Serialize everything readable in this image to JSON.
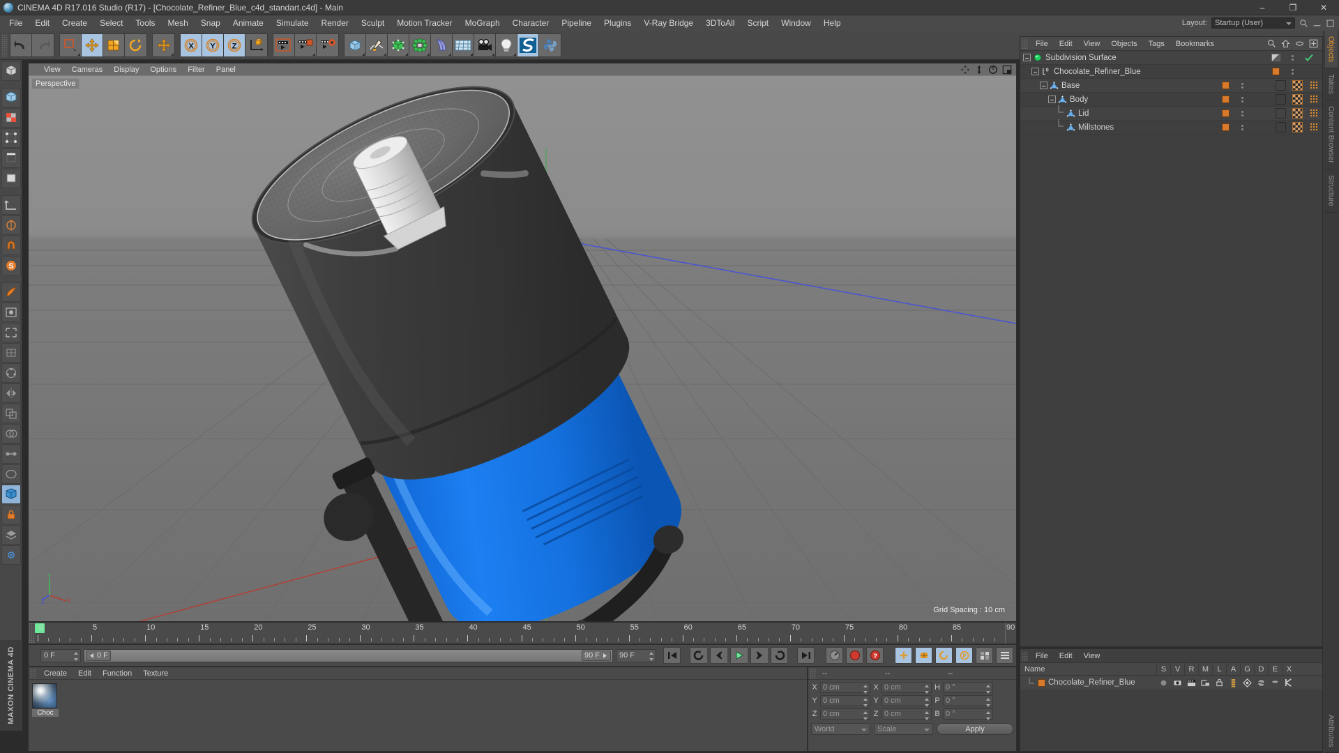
{
  "window": {
    "title": "CINEMA 4D R17.016 Studio (R17) - [Chocolate_Refiner_Blue_c4d_standart.c4d] - Main",
    "app_icon": "c4d-sphere-icon",
    "minimize": "–",
    "maximize": "❐",
    "close": "✕"
  },
  "menubar": {
    "items": [
      "File",
      "Edit",
      "Create",
      "Select",
      "Tools",
      "Mesh",
      "Snap",
      "Animate",
      "Simulate",
      "Render",
      "Sculpt",
      "Motion Tracker",
      "MoGraph",
      "Character",
      "Pipeline",
      "Plugins",
      "V-Ray Bridge",
      "3DToAll",
      "Script",
      "Window",
      "Help"
    ],
    "layout_label": "Layout:",
    "layout_value": "Startup (User)"
  },
  "toolbar": {
    "groups": [
      {
        "name": "history",
        "buttons": [
          {
            "name": "undo-button",
            "icon": "undo-arrow-icon",
            "active": false
          },
          {
            "name": "redo-button",
            "icon": "redo-arrow-icon",
            "active": false
          }
        ]
      },
      {
        "name": "selection-tools",
        "buttons": [
          {
            "name": "live-selection-button",
            "icon": "live-selection-icon",
            "active": false
          },
          {
            "name": "move-tool-button",
            "icon": "move-arrows-icon",
            "active": true
          },
          {
            "name": "scale-tool-button",
            "icon": "scale-box-icon",
            "active": false
          },
          {
            "name": "rotate-tool-button",
            "icon": "rotate-circle-icon",
            "active": false
          }
        ]
      },
      {
        "name": "transform",
        "buttons": [
          {
            "name": "transform-tool-button",
            "icon": "move-arrows-icon",
            "active": false
          }
        ]
      },
      {
        "name": "axis-locks",
        "buttons": [
          {
            "name": "x-axis-lock-button",
            "icon": "axis-x-icon",
            "active": true
          },
          {
            "name": "y-axis-lock-button",
            "icon": "axis-y-icon",
            "active": true
          },
          {
            "name": "z-axis-lock-button",
            "icon": "axis-z-icon",
            "active": true
          },
          {
            "name": "world-coordinate-button",
            "icon": "world-axis-cube-icon",
            "active": false
          }
        ]
      },
      {
        "name": "render",
        "buttons": [
          {
            "name": "render-view-button",
            "icon": "render-clapper-icon",
            "active": false
          },
          {
            "name": "render-to-picture-viewer-button",
            "icon": "render-picture-icon",
            "active": false
          },
          {
            "name": "render-settings-button",
            "icon": "render-settings-gear-icon",
            "active": false
          }
        ]
      },
      {
        "name": "create-objects",
        "buttons": [
          {
            "name": "add-cube-button",
            "icon": "cube-icon",
            "active": false
          },
          {
            "name": "add-spline-button",
            "icon": "pen-spline-icon",
            "active": false
          },
          {
            "name": "add-generator-button",
            "icon": "green-cube-generator-icon",
            "active": false
          },
          {
            "name": "add-array-button",
            "icon": "mograph-cloner-icon",
            "active": false
          },
          {
            "name": "add-deformer-button",
            "icon": "bend-deformer-icon",
            "active": false
          },
          {
            "name": "add-scene-object-button",
            "icon": "floor-grid-icon",
            "active": false
          },
          {
            "name": "add-camera-button",
            "icon": "camera-icon",
            "active": false
          },
          {
            "name": "add-light-button",
            "icon": "light-bulb-icon",
            "active": false
          },
          {
            "name": "cineman-button",
            "icon": "cineman-icon",
            "active": true
          },
          {
            "name": "python-button",
            "icon": "python-icon",
            "active": false
          }
        ]
      }
    ]
  },
  "left_toolbar": {
    "buttons": [
      {
        "name": "make-editable-button",
        "icon": "make-editable-icon",
        "active": false
      },
      {
        "name": "model-mode-button",
        "icon": "model-mode-icon",
        "active": false
      },
      {
        "name": "texture-mode-button",
        "icon": "texture-mode-icon",
        "active": false
      },
      {
        "name": "points-mode-button",
        "icon": "points-mode-icon",
        "active": false
      },
      {
        "name": "edges-mode-button",
        "icon": "edges-mode-icon",
        "active": false
      },
      {
        "name": "polygons-mode-button",
        "icon": "polygons-mode-icon",
        "active": false
      },
      {
        "name": "object-axis-button",
        "icon": "object-axis-icon",
        "active": false
      },
      {
        "name": "enable-axis-button",
        "icon": "enable-axis-icon",
        "active": false
      },
      {
        "name": "snap-settings-button",
        "icon": "magnet-snap-icon",
        "active": false
      },
      {
        "name": "workplane-button",
        "icon": "workplane-s-icon",
        "active": false
      },
      {
        "name": "uv-polygon-button",
        "icon": "uv-polygon-icon",
        "active": false
      },
      {
        "name": "viewport-solo-button",
        "icon": "viewport-solo-icon",
        "active": false
      },
      {
        "name": "render-region-button",
        "icon": "render-region-icon",
        "active": false
      },
      {
        "name": "deformer-ffd-button",
        "icon": "ffd-deformer-icon",
        "active": false
      },
      {
        "name": "array-button",
        "icon": "array-icon",
        "active": false
      },
      {
        "name": "symmetry-button",
        "icon": "symmetry-icon",
        "active": false
      },
      {
        "name": "instance-button",
        "icon": "instance-icon",
        "active": false
      },
      {
        "name": "boole-button",
        "icon": "boole-icon",
        "active": false
      },
      {
        "name": "connect-button",
        "icon": "connect-icon",
        "active": false
      },
      {
        "name": "metaball-button",
        "icon": "metaball-icon",
        "active": false
      },
      {
        "name": "subdivision-surface-button",
        "icon": "subdivision-surface-icon",
        "active": true
      },
      {
        "name": "lock-button",
        "icon": "lock-icon",
        "active": false
      },
      {
        "name": "layer-button",
        "icon": "layer-icon",
        "active": false
      },
      {
        "name": "settings-button",
        "icon": "settings-icon",
        "active": false
      }
    ],
    "brand_text": "MAXON CINEMA 4D"
  },
  "viewport": {
    "menu_items": [
      "View",
      "Cameras",
      "Display",
      "Options",
      "Filter",
      "Panel"
    ],
    "view_label": "Perspective",
    "grid_spacing": "Grid Spacing : 10 cm",
    "axis_labels": {
      "x": "X",
      "y": "Y",
      "z": "Z"
    },
    "nav_icons": [
      "pan-icon",
      "dolly-icon",
      "orbit-icon",
      "maximize-viewport-icon"
    ],
    "scene_object": "Chocolate refiner machine (blue body, dark gray drum, wireframe lid)",
    "colors": {
      "background_top": "#8e8e8e",
      "background_bottom": "#777777",
      "body_blue": "#1878e8",
      "drum_dark": "#3a3a3a",
      "x_axis": "#c0392b",
      "y_axis": "#3cb54a",
      "z_axis": "#3b4fd8"
    }
  },
  "timeline": {
    "ticks": [
      0,
      5,
      10,
      15,
      20,
      25,
      30,
      35,
      40,
      45,
      50,
      55,
      60,
      65,
      70,
      75,
      80,
      85,
      90
    ],
    "playhead_frame": 0,
    "min_frame": 0,
    "max_frame": 90
  },
  "transport": {
    "current_frame": "0 F",
    "range_start": "0 F",
    "range_end": "90 F",
    "end_frame": "90 F",
    "buttons": [
      {
        "name": "go-to-start-button",
        "icon": "skip-start-icon"
      },
      {
        "name": "play-reverse-loop-button",
        "icon": "loop-back-icon"
      },
      {
        "name": "step-back-button",
        "icon": "step-back-icon"
      },
      {
        "name": "play-button",
        "icon": "play-icon"
      },
      {
        "name": "step-forward-button",
        "icon": "step-forward-icon"
      },
      {
        "name": "loop-forward-button",
        "icon": "loop-forward-icon"
      },
      {
        "name": "go-to-end-button",
        "icon": "skip-end-icon"
      },
      {
        "name": "autokey-button",
        "icon": "speedometer-icon"
      },
      {
        "name": "record-button",
        "icon": "record-circle-icon"
      },
      {
        "name": "keyframe-help-button",
        "icon": "question-circle-icon"
      },
      {
        "name": "key-position-button",
        "icon": "key-position-icon"
      },
      {
        "name": "key-scale-button",
        "icon": "key-scale-icon"
      },
      {
        "name": "key-rotation-button",
        "icon": "key-rotation-icon"
      },
      {
        "name": "key-param-button",
        "icon": "key-param-icon"
      },
      {
        "name": "key-pla-button",
        "icon": "key-pla-icon"
      },
      {
        "name": "timeline-settings-button",
        "icon": "timeline-settings-icon"
      }
    ]
  },
  "material_manager": {
    "menu_items": [
      "Create",
      "Edit",
      "Function",
      "Texture"
    ],
    "materials": [
      {
        "name": "Choc",
        "full_name": "Chocolate_Refiner_Blue",
        "icon": "material-sphere-icon"
      }
    ]
  },
  "coordinates": {
    "header": [
      "--",
      "--",
      "--"
    ],
    "rows": [
      {
        "pos_label": "X",
        "pos_value": "0 cm",
        "size_label": "X",
        "size_value": "0 cm",
        "rot_label": "H",
        "rot_value": "0 °"
      },
      {
        "pos_label": "Y",
        "pos_value": "0 cm",
        "size_label": "Y",
        "size_value": "0 cm",
        "rot_label": "P",
        "rot_value": "0 °"
      },
      {
        "pos_label": "Z",
        "pos_value": "0 cm",
        "size_label": "Z",
        "size_value": "0 cm",
        "rot_label": "B",
        "rot_value": "0 °"
      }
    ],
    "coord_system": "World",
    "transform_mode": "Scale",
    "apply_label": "Apply"
  },
  "object_manager": {
    "menu_items": [
      "File",
      "Edit",
      "View",
      "Objects",
      "Tags",
      "Bookmarks"
    ],
    "header_icons": [
      "search-icon",
      "home-icon",
      "ellipse-icon",
      "plus-box-icon"
    ],
    "rows": [
      {
        "label": "Subdivision Surface",
        "icon": "subdivision-surface-icon",
        "depth": 0,
        "expandable": true,
        "has_tags": false,
        "visdot": "layer-split",
        "check": true
      },
      {
        "label": "Chocolate_Refiner_Blue",
        "icon": "null-layer-icon",
        "depth": 1,
        "expandable": true,
        "has_tags": false,
        "visdot": "orange",
        "check": false
      },
      {
        "label": "Base",
        "icon": "polygon-object-icon",
        "depth": 2,
        "expandable": true,
        "has_tags": true,
        "visdot": "orange",
        "check": false
      },
      {
        "label": "Body",
        "icon": "polygon-object-icon",
        "depth": 3,
        "expandable": true,
        "has_tags": true,
        "visdot": "orange",
        "check": false
      },
      {
        "label": "Lid",
        "icon": "polygon-object-icon",
        "depth": 4,
        "expandable": false,
        "has_tags": true,
        "visdot": "orange",
        "check": false
      },
      {
        "label": "Millstones",
        "icon": "polygon-object-icon",
        "depth": 4,
        "expandable": false,
        "has_tags": true,
        "visdot": "orange",
        "check": false
      }
    ]
  },
  "layer_manager": {
    "menu_items": [
      "File",
      "Edit",
      "View"
    ],
    "columns": [
      "Name",
      "S",
      "V",
      "R",
      "M",
      "L",
      "A",
      "G",
      "D",
      "E",
      "X"
    ],
    "rows": [
      {
        "name": "Chocolate_Refiner_Blue",
        "swatch": "#d77a2b",
        "cells": [
          "solo-dot-icon",
          "visible-eye-icon",
          "render-clapper-icon",
          "manager-icon",
          "lock-icon",
          "animation-icon",
          "generator-icon",
          "deformer-icon",
          "expression-icon",
          "xref-icon"
        ]
      }
    ]
  },
  "right_tabs": {
    "items": [
      "Objects",
      "Takes",
      "Content Browser",
      "Structure"
    ],
    "active": "Objects",
    "bottom_items": [
      "Attributes"
    ]
  }
}
